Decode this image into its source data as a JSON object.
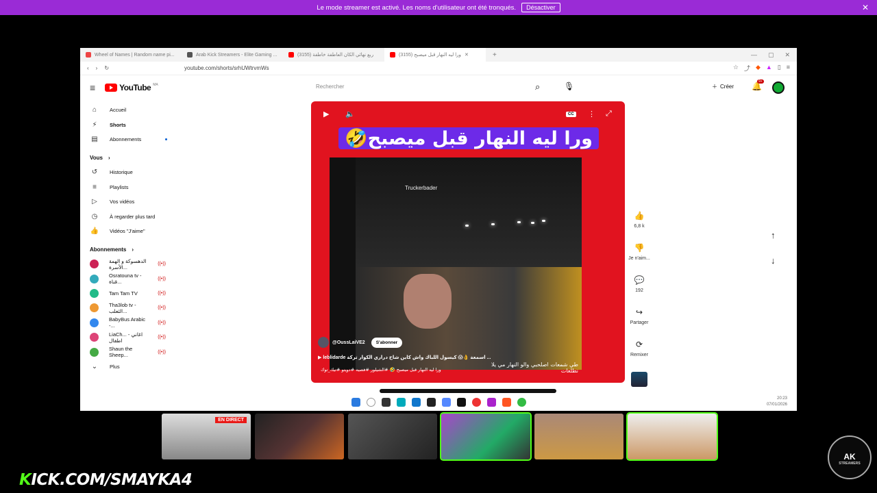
{
  "banner": {
    "text": "Le mode streamer est activé. Les noms d'utilisateur ont été tronqués.",
    "button": "Désactiver",
    "close": "✕"
  },
  "browser": {
    "tabs": [
      {
        "title": "Wheel of Names | Random name pi..."
      },
      {
        "title": "Arab Kick Streamers - Elite Gaming ..."
      },
      {
        "title": "(3155) ربع نهائي الكان العاطفة خاطفة"
      },
      {
        "title": "(3155) ورا ليه النهار قبل ميصبح"
      }
    ],
    "url": "youtube.com/shorts/srhUWtrvmWs"
  },
  "youtube": {
    "logo_text": "YouTube",
    "logo_country": "MA",
    "search_placeholder": "Rechercher",
    "create_label": "Créer",
    "notif_count": "9+",
    "sidebar_main": [
      {
        "label": "Accueil",
        "icon": "home-icon",
        "glyph": "⌂"
      },
      {
        "label": "Shorts",
        "icon": "shorts-icon",
        "glyph": "⚡"
      },
      {
        "label": "Abonnements",
        "icon": "subscriptions-icon",
        "glyph": "▤"
      }
    ],
    "you_section": "Vous",
    "sidebar_you": [
      {
        "label": "Historique",
        "glyph": "↺"
      },
      {
        "label": "Playlists",
        "glyph": "≡"
      },
      {
        "label": "Vos vidéos",
        "glyph": "▷"
      },
      {
        "label": "À regarder plus tard",
        "glyph": "◷"
      },
      {
        "label": "Vidéos \"J'aime\"",
        "glyph": "👍"
      }
    ],
    "subs_section": "Abonnements",
    "subscriptions": [
      {
        "label": "الدهسوكة و الهمة الأسرة...",
        "color": "#c25"
      },
      {
        "label": "Osratouna tv - قناة...",
        "color": "#3ab"
      },
      {
        "label": "Tam Tam TV",
        "color": "#2b8"
      },
      {
        "label": "Tha3lob tv - الثعلب...",
        "color": "#e93"
      },
      {
        "label": "BabyBus Arabic -...",
        "color": "#38e"
      },
      {
        "label": "LiaCh... - اغاني اطفال",
        "color": "#d47"
      },
      {
        "label": "Shaun the Sheep...",
        "color": "#4a4"
      }
    ],
    "more_label": "Plus",
    "video": {
      "title": "ورا ليه النهار قبل ميصبح🤣",
      "watermark": "Truckerbader",
      "channel": "@OussLaiVE2",
      "subscribe": "S'abonner",
      "description": "▶ leblidarde اسمعة 👌😱 كيسول اللباك واش كاين شاح دراري الكوار تركة ...",
      "caption": "طي شمعات اصلحبي والو النهار مي يلا نطلعات",
      "song": "ورا ليه النهار قبل ميصبح 🤣 #الشيلور #فصيه #دويتو #تيك_توك"
    },
    "actions": [
      {
        "icon": "like-icon",
        "glyph": "👍",
        "label": "6,8 k"
      },
      {
        "icon": "dislike-icon",
        "glyph": "👎",
        "label": "Je n'aim..."
      },
      {
        "icon": "comment-icon",
        "glyph": "💬",
        "label": "192"
      },
      {
        "icon": "share-icon",
        "glyph": "↪",
        "label": "Partager"
      },
      {
        "icon": "remix-icon",
        "glyph": "⟳",
        "label": "Remixer"
      }
    ]
  },
  "taskbar": {
    "time": "20:23",
    "date": "07/01/2026"
  },
  "overlay": {
    "live_badge": "EN DIRECT",
    "kick_prefix": "K",
    "kick_rest": "ICK.COM/SMAYKA4",
    "ak_logo": "AK",
    "ak_sub": "STREAMERS"
  }
}
